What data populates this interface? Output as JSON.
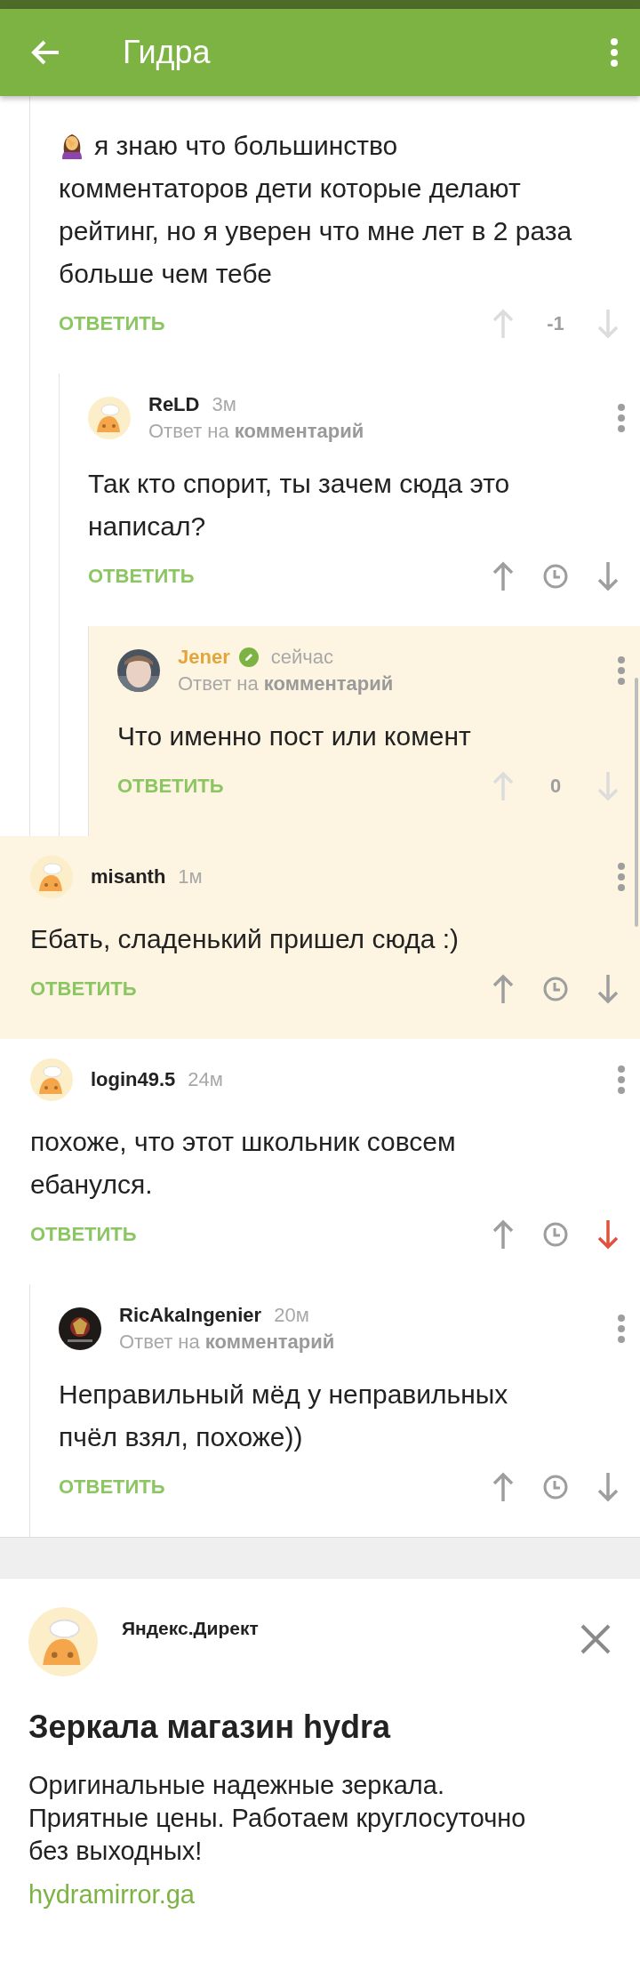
{
  "app_bar": {
    "title": "Гидра"
  },
  "comments": [
    {
      "kind": "offscreen",
      "children": [
        {
          "kind": "comment",
          "highlighted": false,
          "emoji": true,
          "text": "я знаю что большинство\nкомментаторов дети которые делают\nрейтинг, но я уверен что мне лет в 2 раза\nбольше чем тебе",
          "reply": "ОТВЕТИТЬ",
          "rating": {
            "kind": "score",
            "value": "-1"
          },
          "downvoted": false,
          "children": [
            {
              "kind": "comment",
              "highlighted": false,
              "avatar": {
                "kind": "default"
              },
              "author": "ReLD",
              "own": false,
              "time": "3м",
              "reply_to": {
                "prefix": "Ответ на",
                "target": "комментарий"
              },
              "text": "Так кто спорит, ты зачем сюда это\nнаписал?",
              "reply": "ОТВЕТИТЬ",
              "rating": {
                "kind": "hidden"
              },
              "downvoted": false,
              "children": [
                {
                  "kind": "comment",
                  "highlighted": true,
                  "author": "Jener",
                  "own": true,
                  "time": "сейчас",
                  "reply_to": {
                    "prefix": "Ответ на",
                    "target": "комментарий"
                  },
                  "text": "Что именно пост или комент",
                  "reply": "ОТВЕТИТЬ",
                  "rating": {
                    "kind": "score",
                    "value": "0"
                  },
                  "downvoted": false
                }
              ]
            }
          ]
        }
      ]
    },
    {
      "kind": "comment",
      "highlighted": true,
      "avatar": {
        "kind": "default"
      },
      "author": "misanth",
      "own": false,
      "time": "1м",
      "text": "Ебать, сладенький пришел сюда :)",
      "reply": "ОТВЕТИТЬ",
      "rating": {
        "kind": "hidden"
      },
      "downvoted": false
    },
    {
      "kind": "comment",
      "highlighted": false,
      "avatar": {
        "kind": "default"
      },
      "author": "login49.5",
      "own": false,
      "time": "24м",
      "text": "похоже, что этот школьник совсем\nебанулся.",
      "reply": "ОТВЕТИТЬ",
      "rating": {
        "kind": "hidden"
      },
      "downvoted": true,
      "children": [
        {
          "kind": "comment",
          "highlighted": false,
          "avatar": {
            "kind": "emblem"
          },
          "author": "RicAkaIngenier",
          "own": false,
          "time": "20м",
          "reply_to": {
            "prefix": "Ответ на",
            "target": "комментарий"
          },
          "text": "Неправильный мёд у неправильных\nпчёл взял, похоже))",
          "reply": "ОТВЕТИТЬ",
          "rating": {
            "kind": "hidden"
          },
          "downvoted": false
        }
      ]
    }
  ],
  "ad": {
    "source": "Яндекс.Директ",
    "avatar": {
      "kind": "default"
    },
    "title": "Зеркала магазин hydra",
    "text": "Оригинальные надежные зеркала.\nПриятные цены. Работаем круглосуточно\nбез выходных!",
    "link": "hydramirror.ga"
  }
}
